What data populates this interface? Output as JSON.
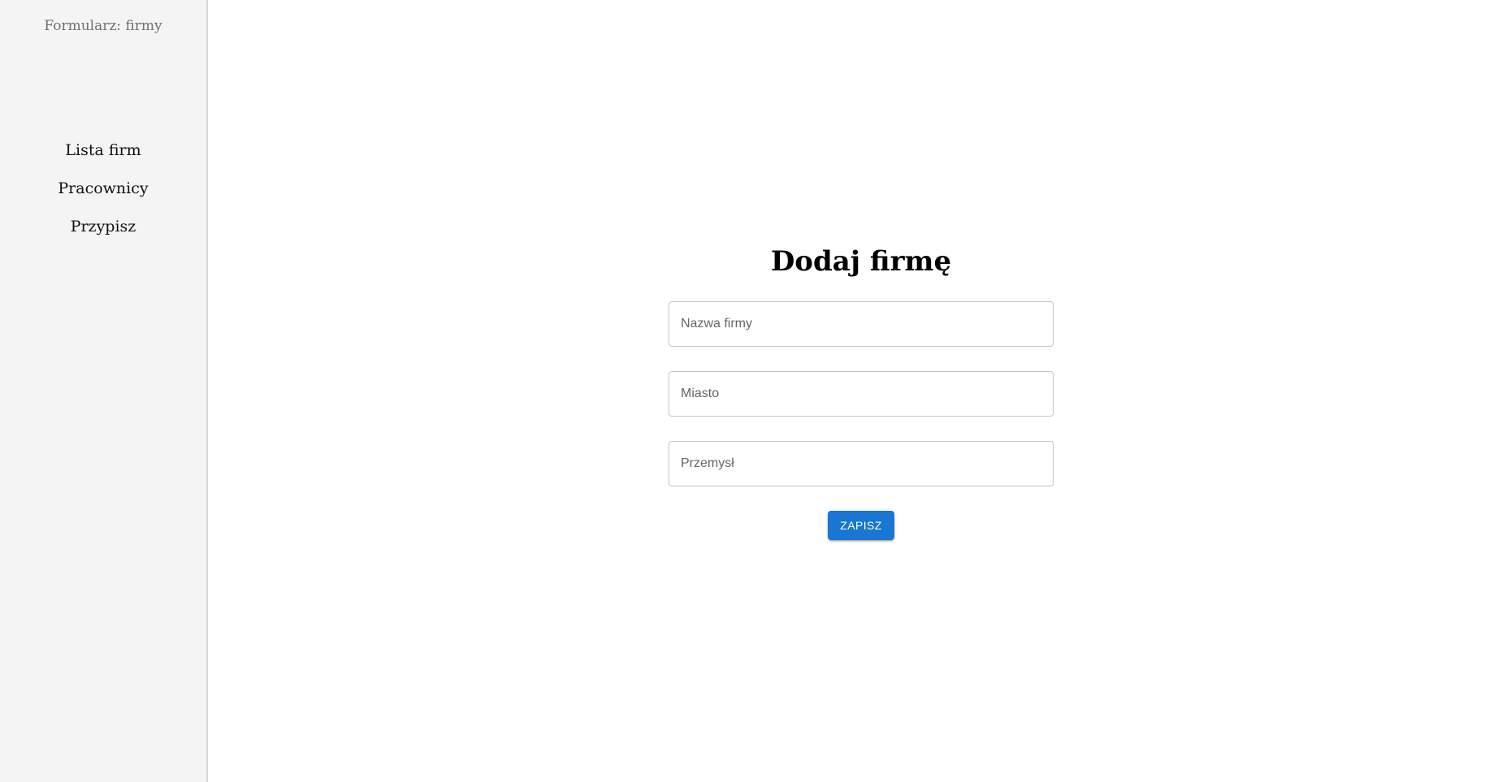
{
  "sidebar": {
    "header": "Formularz: firmy",
    "items": [
      {
        "label": "Lista firm"
      },
      {
        "label": "Pracownicy"
      },
      {
        "label": "Przypisz"
      }
    ]
  },
  "form": {
    "title": "Dodaj firmę",
    "fields": [
      {
        "placeholder": "Nazwa firmy",
        "value": ""
      },
      {
        "placeholder": "Miasto",
        "value": ""
      },
      {
        "placeholder": "Przemysł",
        "value": ""
      }
    ],
    "save_label": "ZAPISZ"
  },
  "colors": {
    "accent": "#1976d2",
    "sidebar_bg": "#f4f4f4"
  }
}
